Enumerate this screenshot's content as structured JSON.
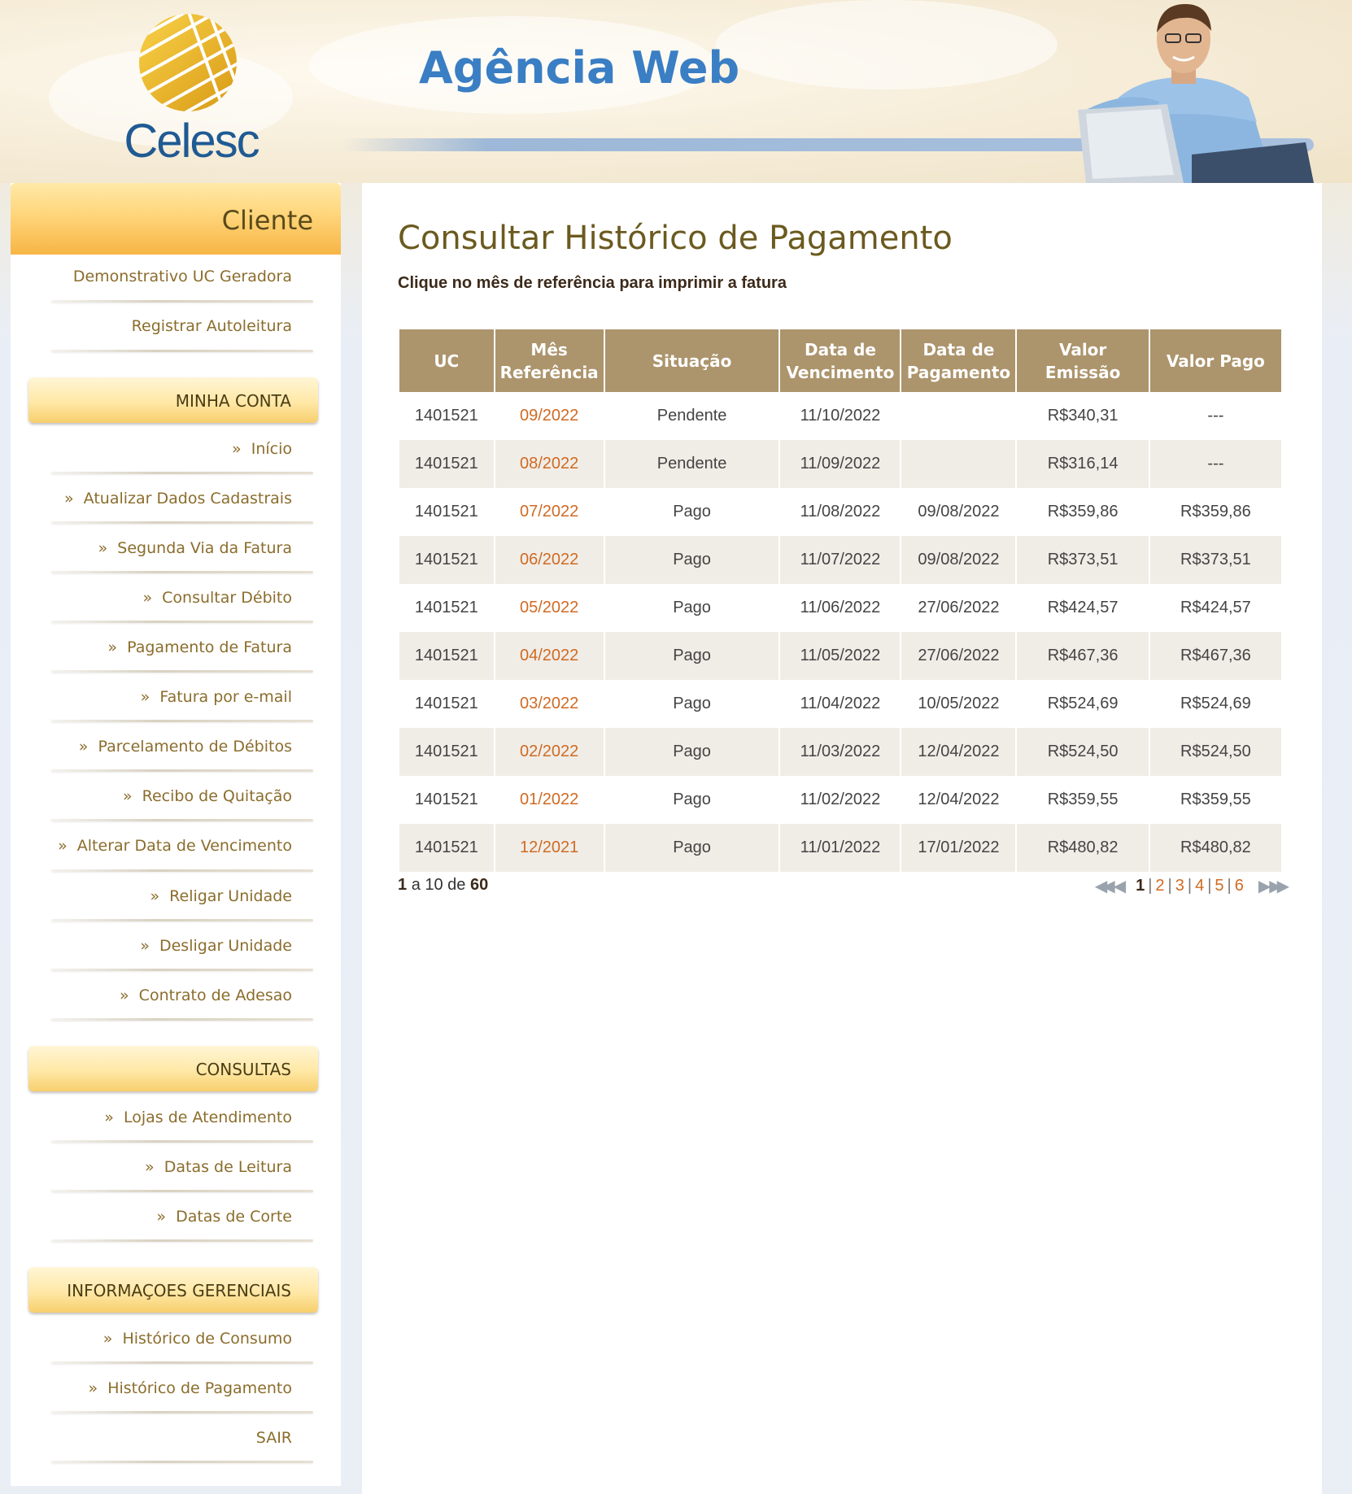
{
  "brand": {
    "logo_text": "Celesc",
    "site_title": "Agência Web"
  },
  "sidebar": {
    "header": "Cliente",
    "top_items": [
      "Demonstrativo UC Geradora",
      "Registrar Autoleitura"
    ],
    "sections": [
      {
        "title": "MINHA CONTA",
        "items": [
          "Início",
          "Atualizar Dados Cadastrais",
          "Segunda Via da Fatura",
          "Consultar Débito",
          "Pagamento de Fatura",
          "Fatura por e-mail",
          "Parcelamento de Débitos",
          "Recibo de Quitação",
          "Alterar Data de Vencimento",
          "Religar Unidade",
          "Desligar Unidade",
          "Contrato de Adesao"
        ]
      },
      {
        "title": "CONSULTAS",
        "items": [
          "Lojas de Atendimento",
          "Datas de Leitura",
          "Datas de Corte"
        ]
      },
      {
        "title": "INFORMAÇOES GERENCIAIS",
        "items": [
          "Histórico de Consumo",
          "Histórico de Pagamento"
        ]
      }
    ],
    "logout": "SAIR",
    "bullet": "»"
  },
  "main": {
    "title": "Consultar Histórico de Pagamento",
    "subtitle": "Clique no mês de referência para imprimir a fatura",
    "columns": [
      "UC",
      "Mês Referência",
      "Situação",
      "Data de Vencimento",
      "Data de Pagamento",
      "Valor Emissão",
      "Valor Pago"
    ],
    "rows": [
      [
        "1401521",
        "09/2022",
        "Pendente",
        "11/10/2022",
        "",
        "R$340,31",
        "---"
      ],
      [
        "1401521",
        "08/2022",
        "Pendente",
        "11/09/2022",
        "",
        "R$316,14",
        "---"
      ],
      [
        "1401521",
        "07/2022",
        "Pago",
        "11/08/2022",
        "09/08/2022",
        "R$359,86",
        "R$359,86"
      ],
      [
        "1401521",
        "06/2022",
        "Pago",
        "11/07/2022",
        "09/08/2022",
        "R$373,51",
        "R$373,51"
      ],
      [
        "1401521",
        "05/2022",
        "Pago",
        "11/06/2022",
        "27/06/2022",
        "R$424,57",
        "R$424,57"
      ],
      [
        "1401521",
        "04/2022",
        "Pago",
        "11/05/2022",
        "27/06/2022",
        "R$467,36",
        "R$467,36"
      ],
      [
        "1401521",
        "03/2022",
        "Pago",
        "11/04/2022",
        "10/05/2022",
        "R$524,69",
        "R$524,69"
      ],
      [
        "1401521",
        "02/2022",
        "Pago",
        "11/03/2022",
        "12/04/2022",
        "R$524,50",
        "R$524,50"
      ],
      [
        "1401521",
        "01/2022",
        "Pago",
        "11/02/2022",
        "12/04/2022",
        "R$359,55",
        "R$359,55"
      ],
      [
        "1401521",
        "12/2021",
        "Pago",
        "11/01/2022",
        "17/01/2022",
        "R$480,82",
        "R$480,82"
      ]
    ],
    "pager": {
      "from": "1",
      "to_text": "a 10 de",
      "total": "60",
      "pages": [
        "1",
        "2",
        "3",
        "4",
        "5",
        "6"
      ],
      "current": "1",
      "first_icon": "double-left-arrow-icon",
      "prev_icon": "left-arrow-icon",
      "next_icon": "right-arrow-icon",
      "last_icon": "double-right-arrow-icon"
    }
  },
  "colors": {
    "accent_link": "#d06a22",
    "table_header": "#ac946c",
    "title": "#6b5a1f",
    "brand_blue": "#3a7ec4"
  }
}
